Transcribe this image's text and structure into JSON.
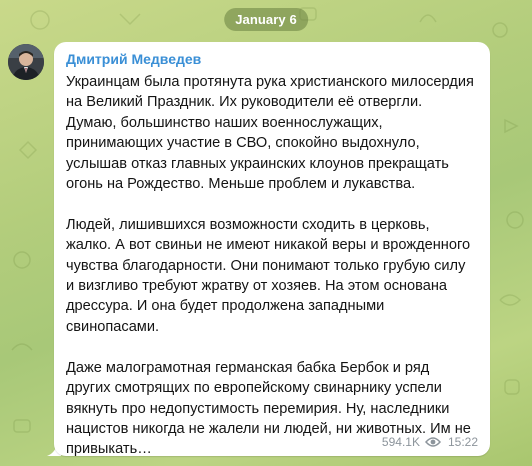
{
  "date_label": "January 6",
  "message": {
    "author": "Дмитрий Медведев",
    "paragraphs": [
      "Украинцам была протянута рука христианского милосердия на Великий Праздник. Их руководители её отвергли. Думаю, большинство наших военнослужащих, принимающих участие в СВО, спокойно выдохнуло, услышав отказ главных украинских клоунов прекращать огонь на Рождество. Меньше проблем и лукавства.",
      "Людей, лишившихся возможности сходить в церковь, жалко. А вот свиньи не имеют никакой веры и врожденного чувства благодарности. Они понимают только грубую силу и визгливо требуют жратву от хозяев. На этом основана дрессура. И она будет продолжена западными свинопасами.",
      "Даже малограмотная германская бабка Бербок и ряд других смотрящих по европейскому свинарнику успели вякнуть про недопустимость перемирия. Ну, наследники нацистов никогда не жалели ни людей, ни животных. Им не привыкать…"
    ],
    "views": "594.1K",
    "time": "15:22"
  },
  "colors": {
    "author": "#3a8fd6",
    "meta": "#8d959c",
    "bubble": "#ffffff"
  },
  "icons": {
    "views": "eye-icon"
  }
}
